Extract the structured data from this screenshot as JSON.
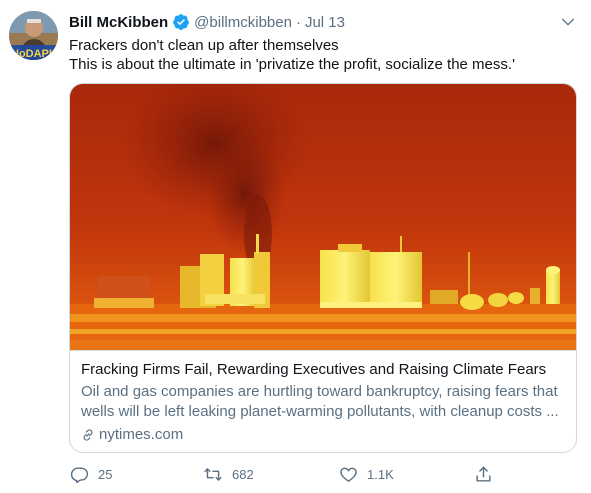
{
  "tweet": {
    "author_name": "Bill McKibben",
    "handle": "@billmckibben",
    "separator": "·",
    "date": "Jul 13",
    "avatar_badge_text": "NoDAPL",
    "text_lines": [
      "Frackers don't clean up after themselves",
      "This is about the ultimate in 'privatize the profit, socialize the mess.'"
    ]
  },
  "card": {
    "title": "Fracking Firms Fail, Rewarding Executives and Raising Climate Fears",
    "description_lines": [
      "Oil and gas companies are hurtling toward bankruptcy, raising fears that",
      "wells will be left leaking planet-warming pollutants, with cleanup costs ..."
    ],
    "domain": "nytimes.com",
    "image_icon": "thermal-image-fracking-site"
  },
  "actions": {
    "reply_count": "25",
    "retweet_count": "682",
    "like_count": "1.1K",
    "reply_icon": "reply-icon",
    "retweet_icon": "retweet-icon",
    "like_icon": "heart-icon",
    "share_icon": "share-icon"
  },
  "colors": {
    "verified_blue": "#1da1f2",
    "secondary_text": "#5b7083",
    "border": "#cfd9de"
  }
}
